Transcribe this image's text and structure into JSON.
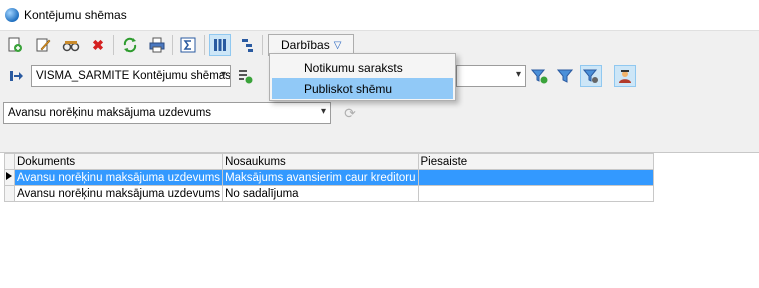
{
  "window": {
    "title": "Kontējumu shēmas"
  },
  "toolbar": {
    "icons": [
      "new-icon",
      "edit-icon",
      "view-icon",
      "delete-icon",
      "refresh-icon",
      "print-icon",
      "sum-icon",
      "grid-view-icon",
      "tree-view-icon"
    ],
    "actions_label": "Darbības"
  },
  "actions_menu": {
    "items": [
      "Notikumu saraksts",
      "Publiskot shēmu"
    ],
    "highlighted_index": 1
  },
  "filter_bar": {
    "scheme_select_value": "VISMA_SARMITE Kontējumu shēmas"
  },
  "document_type": {
    "select_value": "Avansu norēķinu maksājuma uzdevums"
  },
  "grid": {
    "columns": [
      "Dokuments",
      "Nosaukums",
      "Piesaiste"
    ],
    "rows": [
      {
        "dokuments": "Avansu norēķinu maksājuma uzdevums",
        "nosaukums": "Maksājums avansierim caur kreditoru",
        "piesaiste": "",
        "selected": true
      },
      {
        "dokuments": "Avansu norēķinu maksājuma uzdevums",
        "nosaukums": "No sadalījuma",
        "piesaiste": "",
        "selected": false
      }
    ]
  },
  "colors": {
    "selection": "#3399ff",
    "menu_highlight": "#91c9f7"
  }
}
